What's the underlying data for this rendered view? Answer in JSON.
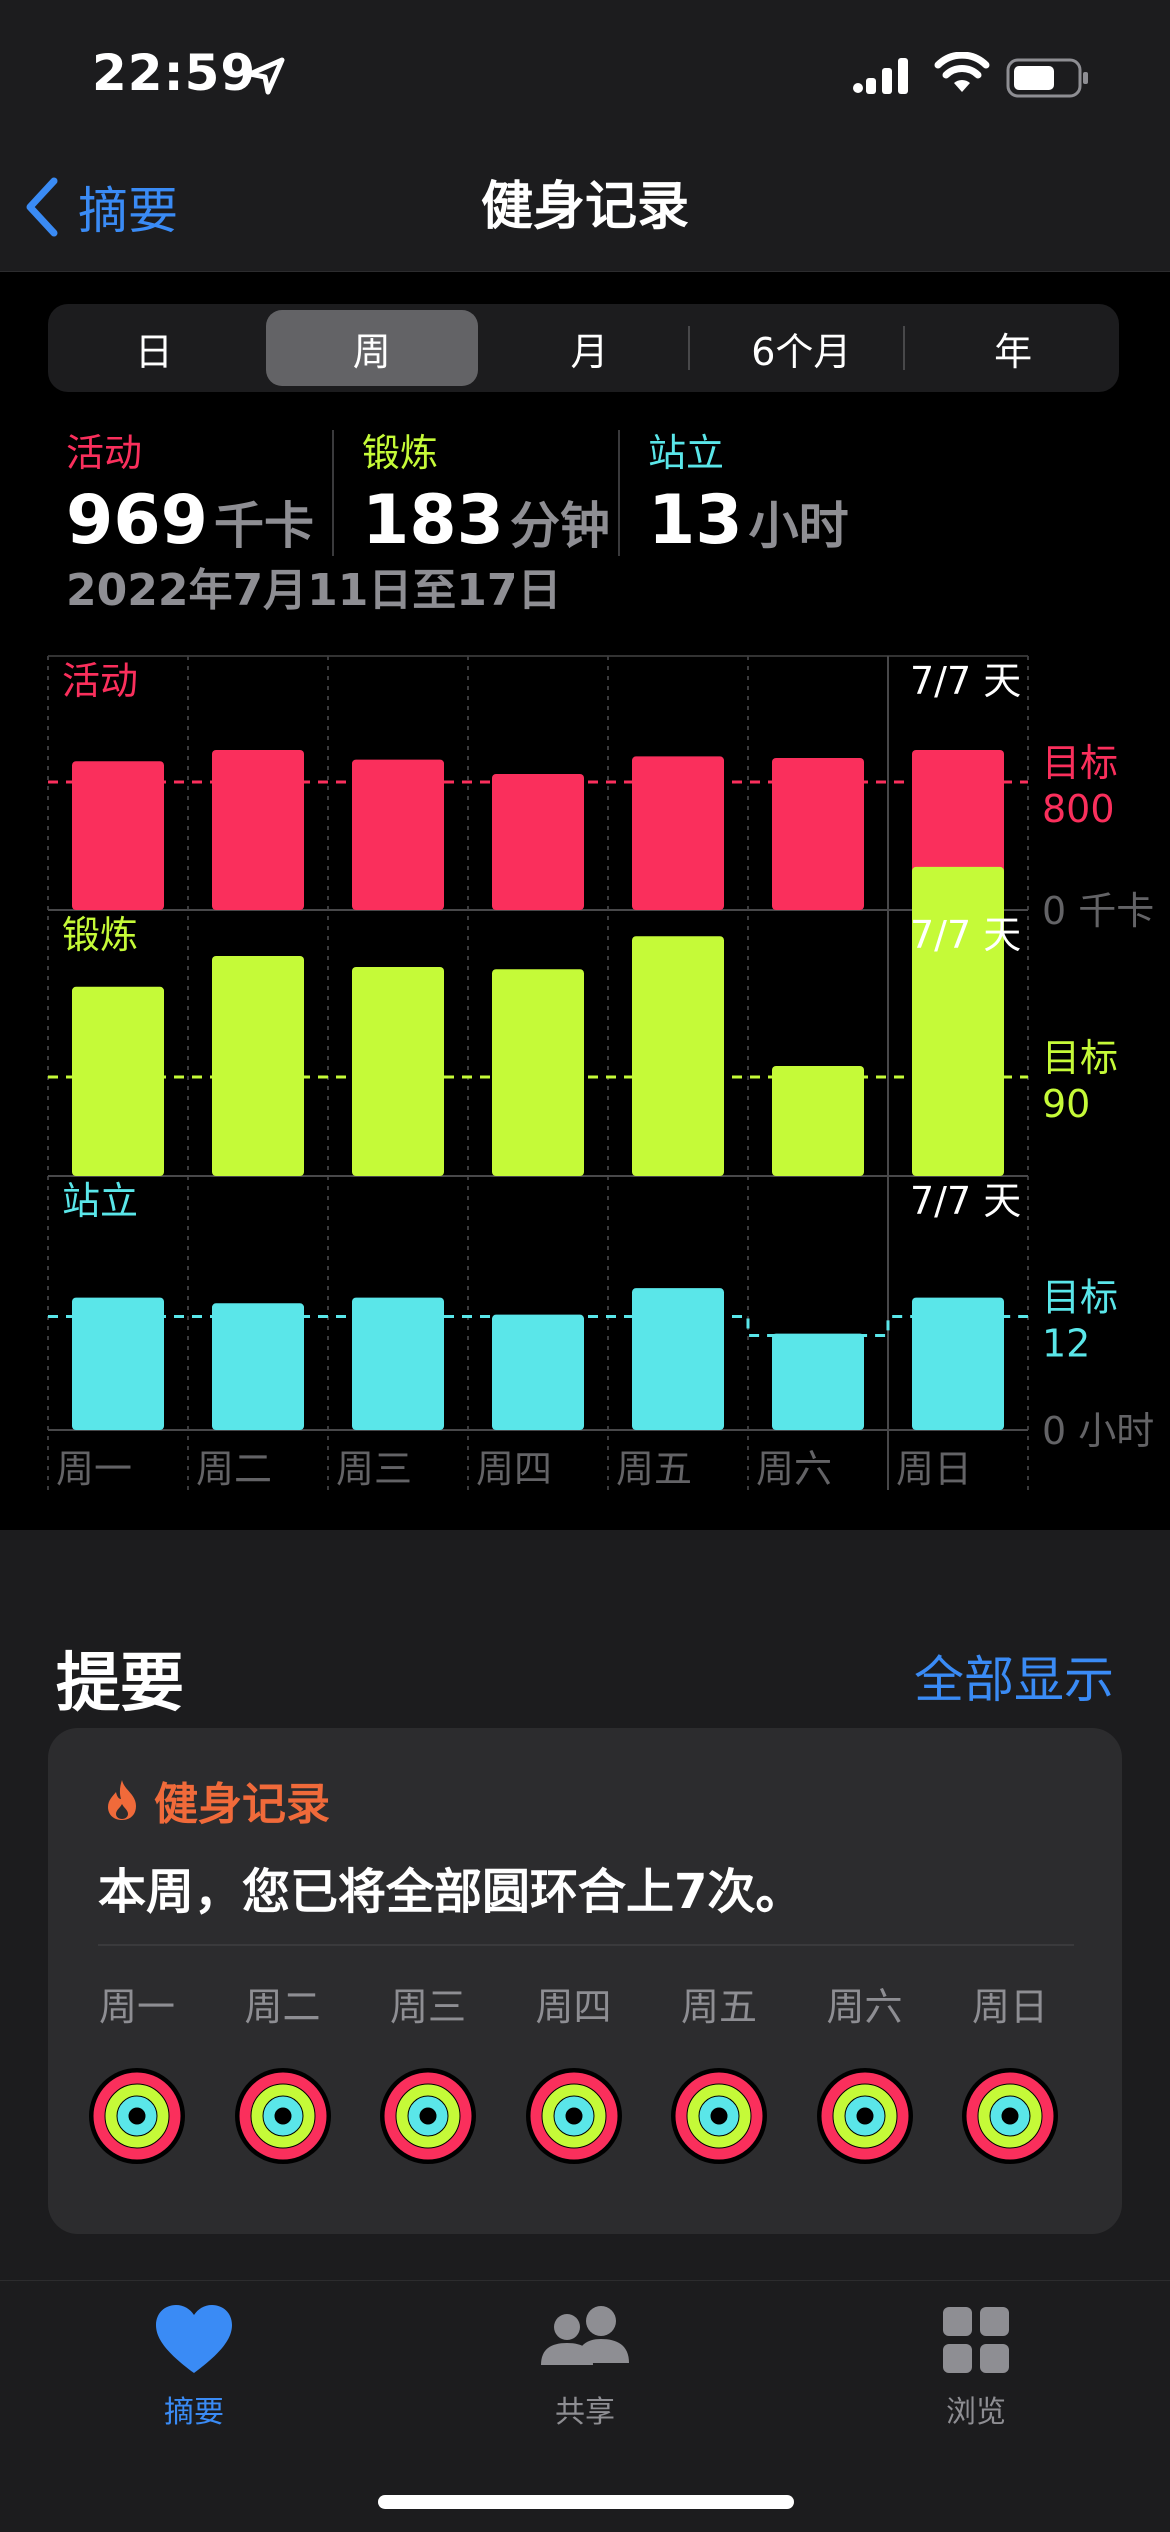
{
  "status_bar": {
    "time": "22:59"
  },
  "nav": {
    "back_label": "摘要",
    "title": "健身记录"
  },
  "segments": [
    "日",
    "周",
    "月",
    "6个月",
    "年"
  ],
  "active_segment": "周",
  "stats": [
    {
      "label": "活动",
      "value": "969",
      "unit": "千卡",
      "color": "#fa2f5c"
    },
    {
      "label": "锻炼",
      "value": "183",
      "unit": "分钟",
      "color": "#c5fa38"
    },
    {
      "label": "站立",
      "value": "13",
      "unit": "小时",
      "color": "#5ae6e9"
    }
  ],
  "date_range": "2022年7月11日至17日",
  "chart_data": {
    "type": "bar",
    "categories": [
      "周一",
      "周二",
      "周三",
      "周四",
      "周五",
      "周六",
      "周日"
    ],
    "panels": [
      {
        "name": "活动",
        "color": "#fa2f5c",
        "days_label": "7/7 天",
        "goal_label": "目标",
        "goal": 800,
        "bottom_label": "0 千卡",
        "ylim": [
          0,
          1300
        ],
        "values": [
          930,
          1000,
          940,
          850,
          960,
          950,
          1000
        ]
      },
      {
        "name": "锻炼",
        "color": "#c5fa38",
        "days_label": "7/7 天",
        "goal_label": "目标",
        "goal": 90,
        "bottom_label": "",
        "ylim": [
          0,
          200
        ],
        "values": [
          172,
          200,
          190,
          188,
          218,
          100,
          281
        ]
      },
      {
        "name": "站立",
        "color": "#5ae6e9",
        "days_label": "7/7 天",
        "goal_label": "目标",
        "goal": 12,
        "bottom_label": "0 小时",
        "ylim": [
          0,
          22
        ],
        "values": [
          14,
          13.4,
          14,
          12.2,
          15,
          10.2,
          14
        ]
      }
    ],
    "goal_per_day": {
      "站立": [
        12,
        12,
        12,
        12,
        12,
        10,
        12
      ]
    }
  },
  "highlights": {
    "title": "提要",
    "show_all": "全部显示",
    "card_title": "健身记录",
    "card_text": "本周，您已将全部圆环合上7次。",
    "days": [
      "周一",
      "周二",
      "周三",
      "周四",
      "周五",
      "周六",
      "周日"
    ]
  },
  "tabs": [
    {
      "label": "摘要",
      "icon": "heart-icon",
      "active": true
    },
    {
      "label": "共享",
      "icon": "people-icon",
      "active": false
    },
    {
      "label": "浏览",
      "icon": "grid-icon",
      "active": false
    }
  ]
}
